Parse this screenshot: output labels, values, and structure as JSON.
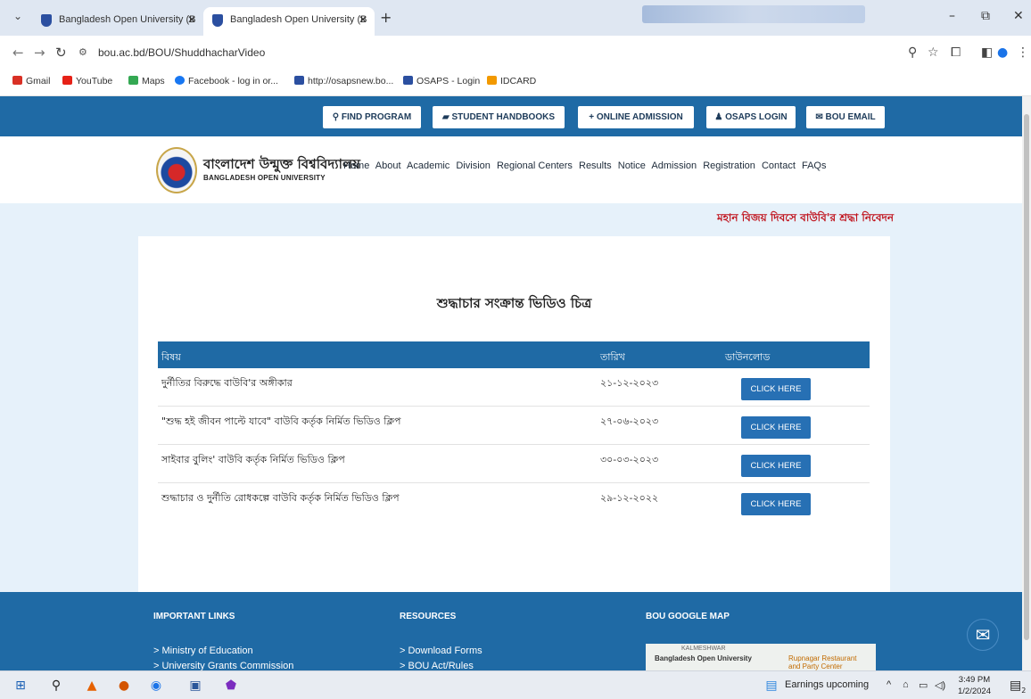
{
  "browser": {
    "tabs": [
      {
        "title": "Bangladesh Open University (B"
      },
      {
        "title": "Bangladesh Open University (B"
      }
    ],
    "url": "bou.ac.bd/BOU/ShuddhacharVideo",
    "bookmarks": [
      {
        "label": "Gmail",
        "color": "#d93025"
      },
      {
        "label": "YouTube",
        "color": "#e62117"
      },
      {
        "label": "Maps",
        "color": "#34a853"
      },
      {
        "label": "Facebook - log in or...",
        "color": "#1877f2"
      },
      {
        "label": "http://osapsnew.bo...",
        "color": "#2b4fa0"
      },
      {
        "label": "OSAPS - Login",
        "color": "#2b4fa0"
      },
      {
        "label": "IDCARD",
        "color": "#f29900"
      }
    ]
  },
  "site": {
    "top_buttons": [
      {
        "label": "FIND PROGRAM",
        "icon": "search-icon",
        "glyph": "⚲"
      },
      {
        "label": "STUDENT HANDBOOKS",
        "icon": "book-icon",
        "glyph": "▰"
      },
      {
        "label": "ONLINE ADMISSION",
        "icon": "plus-icon",
        "glyph": "+"
      },
      {
        "label": "OSAPS LOGIN",
        "icon": "user-icon",
        "glyph": "♟"
      },
      {
        "label": "BOU EMAIL",
        "icon": "envelope-icon",
        "glyph": "✉"
      }
    ],
    "logo_bn": "বাংলাদেশ উন্মুক্ত বিশ্ববিদ্যালয়",
    "logo_en": "BANGLADESH OPEN UNIVERSITY",
    "nav": [
      "Home",
      "About",
      "Academic",
      "Division",
      "Regional Centers",
      "Results",
      "Notice",
      "Admission",
      "Registration",
      "Contact",
      "FAQs"
    ],
    "notice_marquee": "মহান বিজয় দিবসে বাউবি'র শ্রদ্ধা নিবেদন"
  },
  "content": {
    "title": "শুদ্ধাচার সংক্রান্ত ভিডিও চিত্র",
    "columns": {
      "subject": "বিষয়",
      "date": "তারিখ",
      "download": "ডাউনলোড"
    },
    "rows": [
      {
        "subject": "দুর্নীতির বিরুদ্ধে বাউবি'র অঙ্গীকার",
        "date": "২১-১২-২০২৩",
        "action": "CLICK HERE"
      },
      {
        "subject": "\"শুদ্ধ হই জীবন পাল্টে যাবে\" বাউবি কর্তৃক নির্মিত ভিডিও ক্লিপ",
        "date": "২৭-০৬-২০২৩",
        "action": "CLICK HERE"
      },
      {
        "subject": "সাইবার বুলিং' বাউবি কর্তৃক নির্মিত ভিডিও ক্লিপ",
        "date": "৩০-০৩-২০২৩",
        "action": "CLICK HERE"
      },
      {
        "subject": "শুদ্ধাচার ও দুর্নীতি রোধকল্পে বাউবি কর্তৃক নির্মিত ভিডিও ক্লিপ",
        "date": "২৯-১২-২০২২",
        "action": "CLICK HERE"
      }
    ]
  },
  "footer": {
    "important_links": {
      "heading": "IMPORTANT LINKS",
      "links": [
        "> Ministry of Education",
        "> University Grants Commission"
      ]
    },
    "resources": {
      "heading": "RESOURCES",
      "links": [
        "> Download Forms",
        "> BOU Act/Rules"
      ]
    },
    "map": {
      "heading": "BOU GOOGLE MAP",
      "label": "Bangladesh Open University",
      "label2": "Rupnagar Restaurant and Party Center",
      "label3": "KALMESHWAR"
    }
  },
  "taskbar": {
    "news": "Earnings upcoming",
    "time": "3:49 PM",
    "date": "1/2/2024",
    "notification_count": "2"
  },
  "colors": {
    "brand_blue": "#1f6aa5",
    "notice_red": "#c0131d",
    "button_blue": "#2770b4"
  }
}
